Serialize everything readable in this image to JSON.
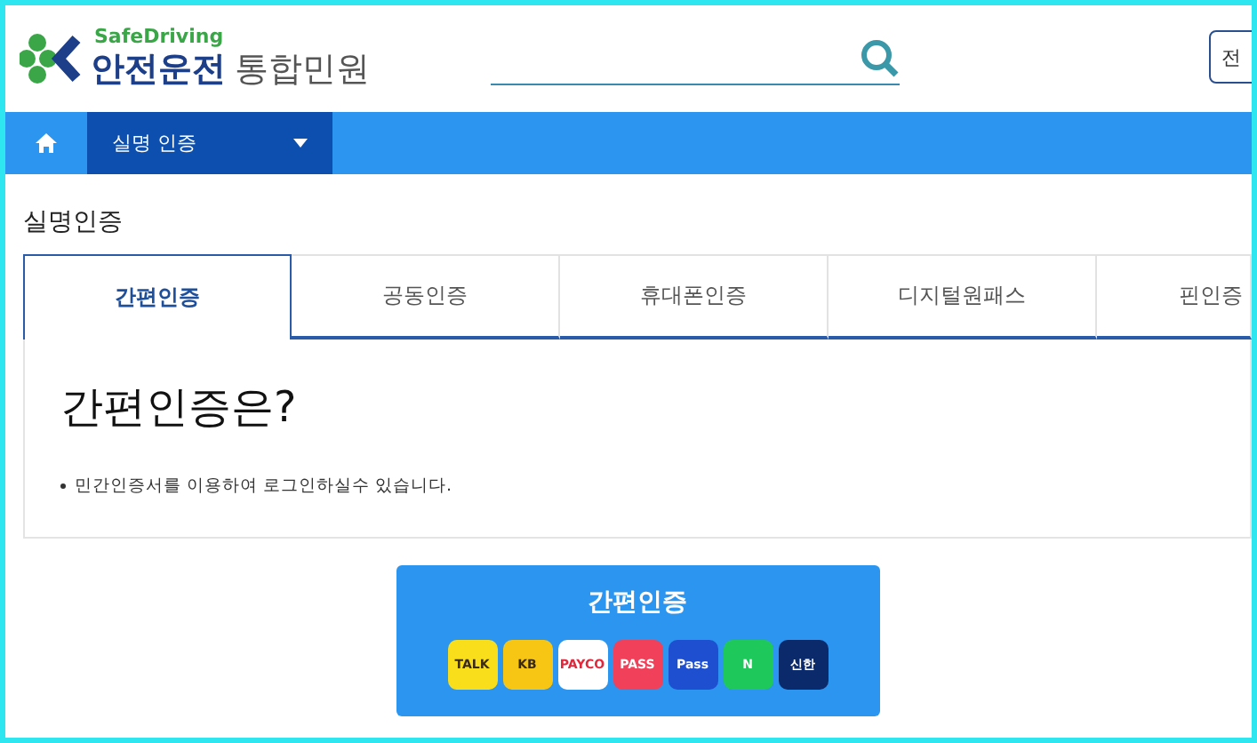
{
  "header": {
    "logo_top": "SafeDriving",
    "logo_main": "안전운전",
    "logo_sub": "통합민원",
    "top_button": "전"
  },
  "nav": {
    "menu": "실명 인증"
  },
  "page_title": "실명인증",
  "tabs": [
    {
      "label": "간편인증",
      "selected": true
    },
    {
      "label": "공동인증",
      "selected": false
    },
    {
      "label": "휴대폰인증",
      "selected": false
    },
    {
      "label": "디지털원패스",
      "selected": false
    },
    {
      "label": "핀인증",
      "selected": false
    }
  ],
  "panel": {
    "heading": "간편인증은?",
    "bullets": [
      "민간인증서를 이용하여 로그인하실수 있습니다."
    ]
  },
  "auth_button": {
    "label": "간편인증",
    "providers": [
      {
        "label": "TALK",
        "color": "#f9df1b"
      },
      {
        "label": "KB",
        "color": "#f7c614"
      },
      {
        "label": "PAYCO",
        "color": "#ffffff"
      },
      {
        "label": "PASS",
        "color": "#f0405a"
      },
      {
        "label": "Pass",
        "color": "#1e4fd0"
      },
      {
        "label": "N",
        "color": "#1fc85a"
      },
      {
        "label": "신한",
        "color": "#0b2a6b"
      }
    ]
  }
}
